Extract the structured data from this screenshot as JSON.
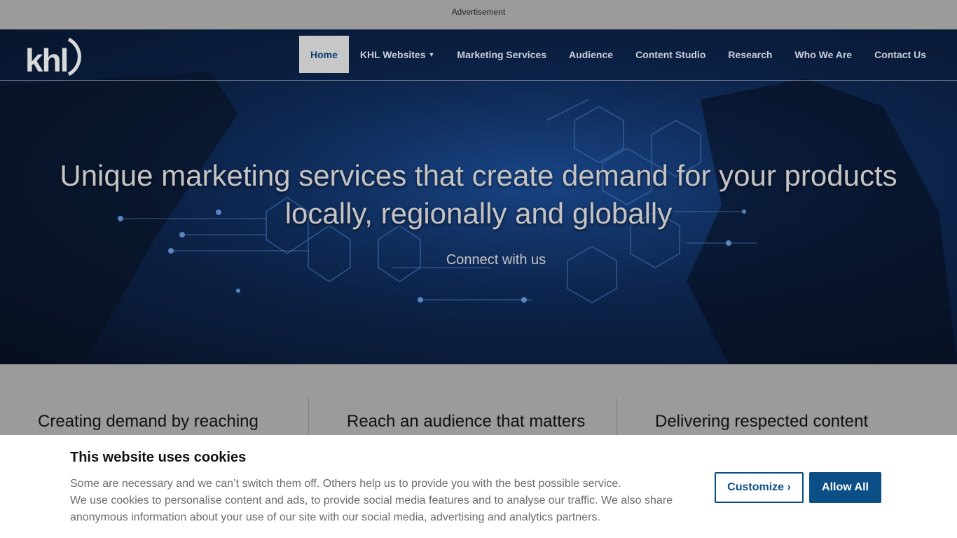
{
  "ad": {
    "label": "Advertisement"
  },
  "brand": {
    "logo_text": "khl"
  },
  "nav": {
    "items": [
      {
        "label": "Home",
        "active": true
      },
      {
        "label": "KHL Websites",
        "dropdown": true
      },
      {
        "label": "Marketing Services"
      },
      {
        "label": "Audience"
      },
      {
        "label": "Content Studio"
      },
      {
        "label": "Research"
      },
      {
        "label": "Who We Are"
      },
      {
        "label": "Contact Us"
      }
    ]
  },
  "hero": {
    "headline_line1": "Unique marketing services that create demand for your products",
    "headline_line2": "locally, regionally and globally",
    "cta": "Connect with us"
  },
  "features": [
    {
      "title": "Creating demand by reaching"
    },
    {
      "title": "Reach an audience that matters"
    },
    {
      "title": "Delivering respected content"
    }
  ],
  "cookie_banner": {
    "title": "This website uses cookies",
    "line1": "Some are necessary and we can’t switch them off. Others help us to provide you with the best possible service.",
    "line2": "We use cookies to personalise content and ads, to provide social media features and to analyse our traffic. We also share anonymous information about your use of our site with our social media, advertising and analytics partners.",
    "customize_label": "Customize ›",
    "allow_all_label": "Allow All"
  },
  "colors": {
    "accent": "#0b4f86",
    "hero_blue": "#0d2650",
    "nav_active_bg": "#c7c7c7"
  }
}
